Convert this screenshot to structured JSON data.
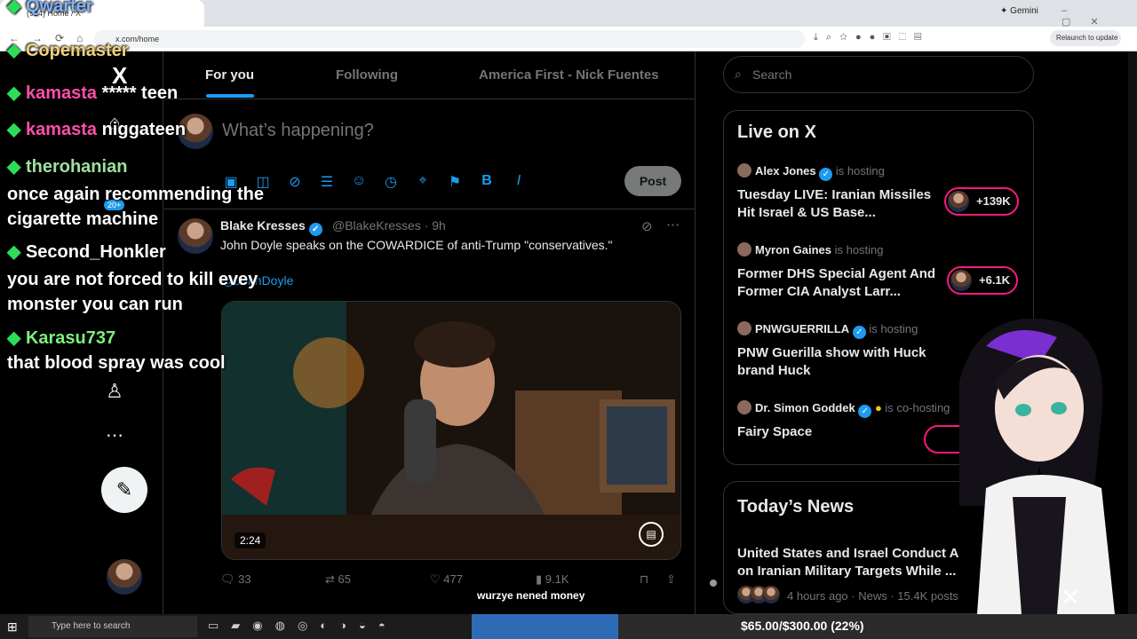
{
  "browser": {
    "tab_title": "(924) Home / X",
    "url": "x.com/home",
    "profile_label": "Gemini",
    "relaunch_label": "Relaunch to update"
  },
  "x": {
    "logo": "X",
    "tabs": [
      "For you",
      "Following",
      "America First - Nick Fuentes"
    ],
    "composer_placeholder": "What’s happening?",
    "post_button": "Post",
    "notification_badge": "20+",
    "tweet": {
      "name": "Blake Kresses",
      "handle": "@BlakeKresses · 9h",
      "text": "John Doyle speaks on the COWARDICE of anti-Trump \"conservatives.\"",
      "link": "@JohnDoyle",
      "duration": "2:24",
      "replies": "33",
      "reposts": "65",
      "likes": "477",
      "views": "9.1K"
    },
    "search_placeholder": "Search",
    "live": {
      "title": "Live on X",
      "spaces": [
        {
          "host": "Alex Jones",
          "role": "is hosting",
          "title": "Tuesday LIVE: Iranian Missiles Hit Israel & US Base...",
          "count": "+139K"
        },
        {
          "host": "Myron Gaines",
          "role": "is hosting",
          "title": "Former DHS Special Agent And Former CIA Analyst Larr...",
          "count": "+6.1K"
        },
        {
          "host": "PNWGUERRILLA",
          "role": "is hosting",
          "title": "PNW Guerilla show with Huck brand Huck",
          "count": ""
        },
        {
          "host": "Dr. Simon Goddek",
          "role": "is co-hosting",
          "title": "Fairy Space",
          "count": ""
        }
      ]
    },
    "news": {
      "title": "Today’s News",
      "item_title": "United States and Israel Conduct A on Iranian Military Targets While ...",
      "item_meta": "4 hours ago · News · 15.4K posts"
    }
  },
  "overlay": {
    "chat": [
      {
        "user": "Qwarter",
        "message": ""
      },
      {
        "user": "Copemaster",
        "message": ""
      },
      {
        "user": "kamasta",
        "message": "***** teen"
      },
      {
        "user": "kamasta",
        "message": "niggateen"
      },
      {
        "user": "therohanian",
        "message": "once again recommending the cigarette machine"
      },
      {
        "user": "Second_Honkler",
        "message": "you are not forced to kill evey monster you can run"
      },
      {
        "user": "Karasu737",
        "message": "that blood spray was cool"
      }
    ],
    "subtitle": "wurzye nened money",
    "donation_text": "$65.00/$300.00 (22%)",
    "donation_progress": 0.22
  },
  "taskbar": {
    "search_placeholder": "Type here to search"
  },
  "colors": {
    "accent": "#1d9bf0",
    "live_border": "#f91880",
    "donation_fill": "#2d6cb5"
  }
}
